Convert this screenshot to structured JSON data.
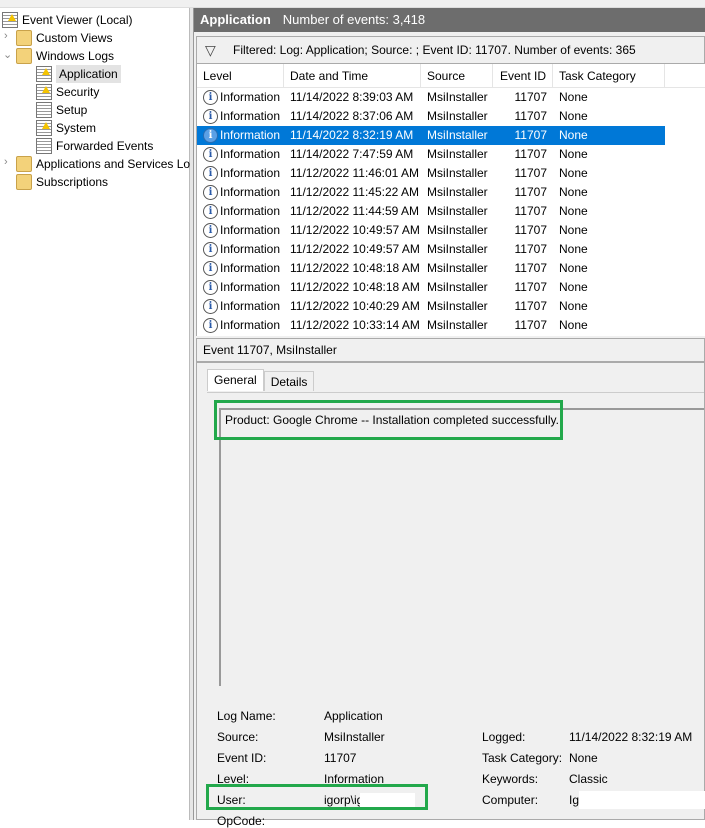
{
  "tree": {
    "root": "Event Viewer (Local)",
    "custom_views": "Custom Views",
    "windows_logs": "Windows Logs",
    "logs": [
      "Application",
      "Security",
      "Setup",
      "System",
      "Forwarded Events"
    ],
    "apps_services": "Applications and Services Lo",
    "subscriptions": "Subscriptions"
  },
  "header": {
    "title": "Application",
    "count": "Number of events: 3,418"
  },
  "filter": {
    "text": "Filtered: Log: Application; Source: ; Event ID: 11707. Number of events: 365"
  },
  "columns": [
    "Level",
    "Date and Time",
    "Source",
    "Event ID",
    "Task Category"
  ],
  "rows": [
    [
      "Information",
      "11/14/2022 8:39:03 AM",
      "MsiInstaller",
      "11707",
      "None"
    ],
    [
      "Information",
      "11/14/2022 8:37:06 AM",
      "MsiInstaller",
      "11707",
      "None"
    ],
    [
      "Information",
      "11/14/2022 8:32:19 AM",
      "MsiInstaller",
      "11707",
      "None"
    ],
    [
      "Information",
      "11/14/2022 7:47:59 AM",
      "MsiInstaller",
      "11707",
      "None"
    ],
    [
      "Information",
      "11/12/2022 11:46:01 AM",
      "MsiInstaller",
      "11707",
      "None"
    ],
    [
      "Information",
      "11/12/2022 11:45:22 AM",
      "MsiInstaller",
      "11707",
      "None"
    ],
    [
      "Information",
      "11/12/2022 11:44:59 AM",
      "MsiInstaller",
      "11707",
      "None"
    ],
    [
      "Information",
      "11/12/2022 10:49:57 AM",
      "MsiInstaller",
      "11707",
      "None"
    ],
    [
      "Information",
      "11/12/2022 10:49:57 AM",
      "MsiInstaller",
      "11707",
      "None"
    ],
    [
      "Information",
      "11/12/2022 10:48:18 AM",
      "MsiInstaller",
      "11707",
      "None"
    ],
    [
      "Information",
      "11/12/2022 10:48:18 AM",
      "MsiInstaller",
      "11707",
      "None"
    ],
    [
      "Information",
      "11/12/2022 10:40:29 AM",
      "MsiInstaller",
      "11707",
      "None"
    ],
    [
      "Information",
      "11/12/2022 10:33:14 AM",
      "MsiInstaller",
      "11707",
      "None"
    ]
  ],
  "selected_row": 2,
  "event": {
    "title": "Event 11707, MsiInstaller",
    "tabs": [
      "General",
      "Details"
    ],
    "message": "Product: Google Chrome -- Installation completed successfully.",
    "fields": {
      "log_name_label": "Log Name:",
      "log_name": "Application",
      "source_label": "Source:",
      "source": "MsiInstaller",
      "event_id_label": "Event ID:",
      "event_id": "11707",
      "level_label": "Level:",
      "level": "Information",
      "user_label": "User:",
      "user": "igorp\\igo",
      "opcode_label": "OpCode:",
      "logged_label": "Logged:",
      "logged": "11/14/2022 8:32:19 AM",
      "task_label": "Task Category:",
      "task": "None",
      "keywords_label": "Keywords:",
      "keywords": "Classic",
      "computer_label": "Computer:",
      "computer": "Ig"
    }
  },
  "colors": {
    "selection": "#0078d7",
    "highlight": "#22a84b",
    "header": "#6d6d6d"
  }
}
